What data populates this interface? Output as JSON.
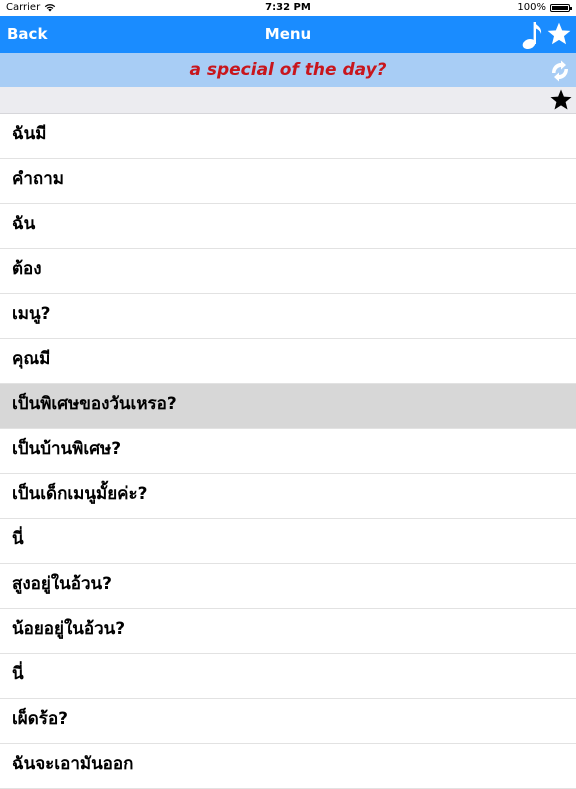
{
  "status_bar": {
    "carrier": "Carrier",
    "time": "7:32 PM",
    "battery": "100%",
    "battery_level": 1.0
  },
  "nav_bar": {
    "back_label": "Back",
    "title": "Menu",
    "music_icon": "music-note-icon",
    "favorite_icon": "star-icon"
  },
  "phrase_bar": {
    "text": "a special of the day?",
    "icon": "shuffle-icon"
  },
  "sub_bar": {
    "icon": "star-icon"
  },
  "colors": {
    "nav_bg": "#1a8cff",
    "phrase_bg": "#a8cdf5",
    "phrase_text": "#c8161d",
    "selected_row": "#d7d7d7"
  },
  "list": {
    "selected_index": 6,
    "items": [
      {
        "label": "ฉันมี"
      },
      {
        "label": "คำถาม"
      },
      {
        "label": "ฉัน"
      },
      {
        "label": "ต้อง"
      },
      {
        "label": "เมนู?"
      },
      {
        "label": "คุณมี"
      },
      {
        "label": "เป็นพิเศษของวันเหรอ?"
      },
      {
        "label": "เป็นบ้านพิเศษ?"
      },
      {
        "label": "เป็นเด็กเมนูมั้ยค่ะ?"
      },
      {
        "label": "นี่"
      },
      {
        "label": "สูงอยู่ในอ้วน?"
      },
      {
        "label": "น้อยอยู่ในอ้วน?"
      },
      {
        "label": "นี่"
      },
      {
        "label": "เผ็ดร้อ?"
      },
      {
        "label": "ฉันจะเอามันออก"
      }
    ]
  }
}
